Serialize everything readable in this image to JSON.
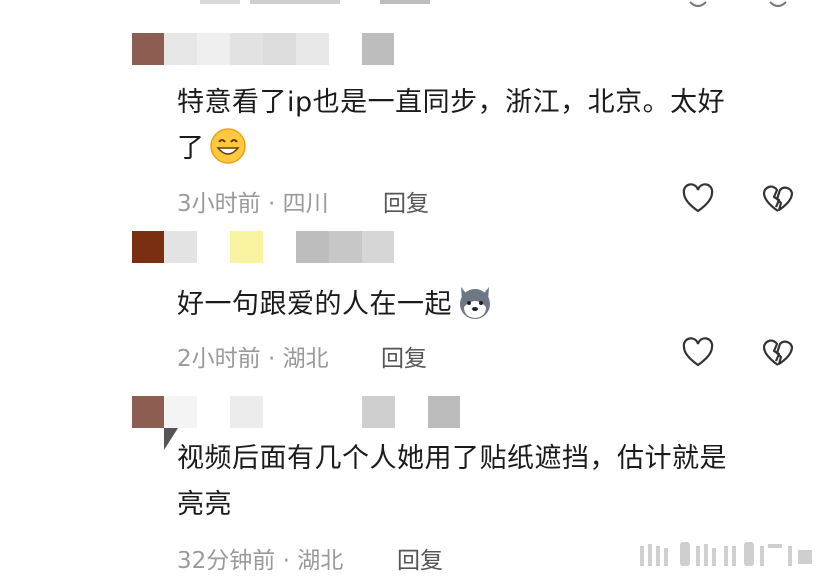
{
  "comments": [
    {
      "text_line1": "特意看了ip也是一直同步，浙江，北京。太好",
      "text_line2": "了",
      "emoji": "grinning-face-emoji",
      "time": "3小时前",
      "location": "四川",
      "reply_label": "回复"
    },
    {
      "text_line1": "好一句跟爱的人在一起",
      "emoji": "husky-dog-emoji",
      "time": "2小时前",
      "location": "湖北",
      "reply_label": "回复"
    },
    {
      "text_line1": "视频后面有几个人她用了贴纸遮挡，估计就是",
      "text_line2": "亮亮",
      "time": "32分钟前",
      "location": "湖北",
      "reply_label": "回复"
    }
  ],
  "meta_separator": "·",
  "colors": {
    "text": "#1b1b1b",
    "meta": "#9a9a9a",
    "icon_stroke": "#333333",
    "background": "#ffffff"
  },
  "icons": [
    "heart-outline-icon",
    "broken-heart-icon"
  ]
}
